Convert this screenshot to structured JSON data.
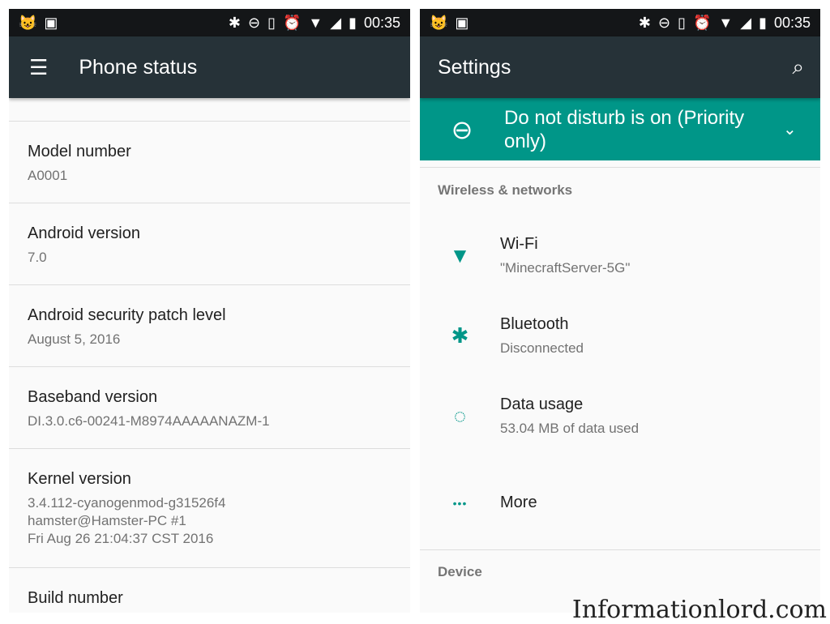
{
  "status_bar": {
    "time": "00:35"
  },
  "left": {
    "title": "Phone status",
    "items": [
      {
        "title": "Model number",
        "value": "A0001"
      },
      {
        "title": "Android version",
        "value": "7.0"
      },
      {
        "title": "Android security patch level",
        "value": "August 5, 2016"
      },
      {
        "title": "Baseband version",
        "value": "DI.3.0.c6-00241-M8974AAAAANAZM-1"
      },
      {
        "title": "Kernel version",
        "value": "3.4.112-cyanogenmod-g31526f4\nhamster@Hamster-PC #1\nFri Aug 26 21:04:37 CST 2016"
      },
      {
        "title": "Build number",
        "value": ""
      }
    ]
  },
  "right": {
    "title": "Settings",
    "dnd": "Do not disturb is on (Priority only)",
    "section1": "Wireless & networks",
    "items": [
      {
        "title": "Wi-Fi",
        "value": "\"MinecraftServer-5G\"",
        "icon": "wifi-icon"
      },
      {
        "title": "Bluetooth",
        "value": "Disconnected",
        "icon": "bluetooth-icon"
      },
      {
        "title": "Data usage",
        "value": "53.04 MB of data used",
        "icon": "data-usage-icon"
      },
      {
        "title": "More",
        "value": "",
        "icon": "more-icon"
      }
    ],
    "section2": "Device"
  },
  "watermark": "Informationlord.com",
  "colors": {
    "appbar": "#263238",
    "accent": "#009688"
  }
}
